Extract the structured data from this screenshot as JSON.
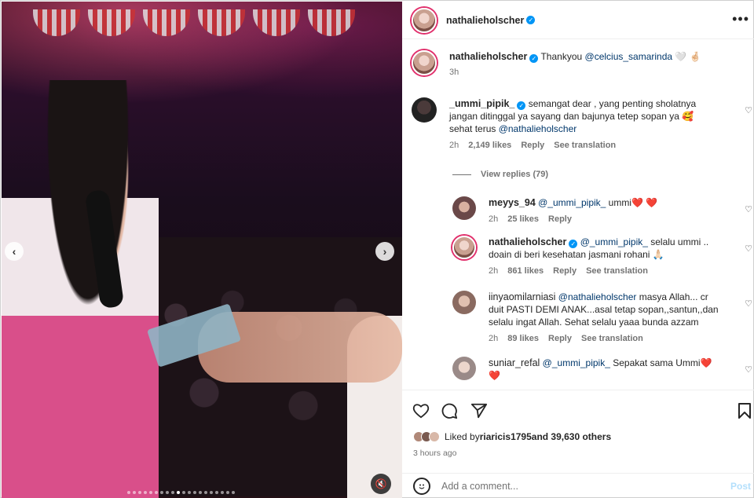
{
  "media": {
    "prev_icon": "chevron-left-icon",
    "next_icon": "chevron-right-icon",
    "mute_icon": "speaker-muted-icon",
    "slide_count": 20,
    "active_slide": 9
  },
  "header": {
    "username": "nathalieholscher",
    "verified": true,
    "more_label": "•••"
  },
  "caption": {
    "username": "nathalieholscher",
    "text_prefix": "Thankyou ",
    "mention": "@celcius_samarinda",
    "text_suffix": " 🤍 🤞🏻",
    "time": "3h"
  },
  "comments": [
    {
      "username": "_ummi_pipik_",
      "verified": true,
      "text_line1": "semangat dear , yang penting sholatnya",
      "text_line2": "jangan ditinggal ya sayang dan bajunya tetep sopan ya 🥰",
      "text_line3_prefix": "sehat terus ",
      "text_line3_mention": "@nathalieholscher",
      "time": "2h",
      "likes": "2,149 likes",
      "reply": "Reply",
      "translate": "See translation"
    }
  ],
  "view_replies": "View replies (79)",
  "replies": [
    {
      "username": "meyys_94",
      "mention": "@_ummi_pipik_",
      "text": " ummi❤️ ❤️",
      "time": "2h",
      "likes": "25 likes",
      "reply": "Reply"
    },
    {
      "username": "nathalieholscher",
      "verified": true,
      "mention": "@_ummi_pipik_",
      "text_line1": " selalu ummi ..",
      "text_line2": "doain di beri kesehatan jasmani rohani 🙏🏻",
      "time": "2h",
      "likes": "861 likes",
      "reply": "Reply",
      "translate": "See translation"
    },
    {
      "username": "iinyaomilarniasi",
      "mention": "@nathalieholscher",
      "text_line1": " masya Allah... cr",
      "text_line2": "duit PASTI DEMI ANAK...asal tetap sopan,,santun,,dan",
      "text_line3": "selalu ingat Allah. Sehat selalu yaaa bunda azzam",
      "time": "2h",
      "likes": "89 likes",
      "reply": "Reply",
      "translate": "See translation"
    },
    {
      "username": "suniar_refal",
      "mention": "@_ummi_pipik_",
      "text_line1": " Sepakat sama Ummi❤️",
      "text_line2": "❤️"
    }
  ],
  "actions": {
    "like_icon": "heart-icon",
    "comment_icon": "comment-icon",
    "share_icon": "send-icon",
    "save_icon": "bookmark-icon"
  },
  "likes_summary": {
    "prefix": "Liked by ",
    "user": "riaricis1795",
    "suffix": " and 39,630 others"
  },
  "posted": "3 hours ago",
  "add_comment": {
    "placeholder": "Add a comment...",
    "post_label": "Post",
    "emoji_icon": "smiley-icon"
  },
  "colors": {
    "verified": "#0095f6",
    "mention": "#00376b",
    "muted_text": "#737373",
    "post_disabled": "#b3dffc"
  }
}
